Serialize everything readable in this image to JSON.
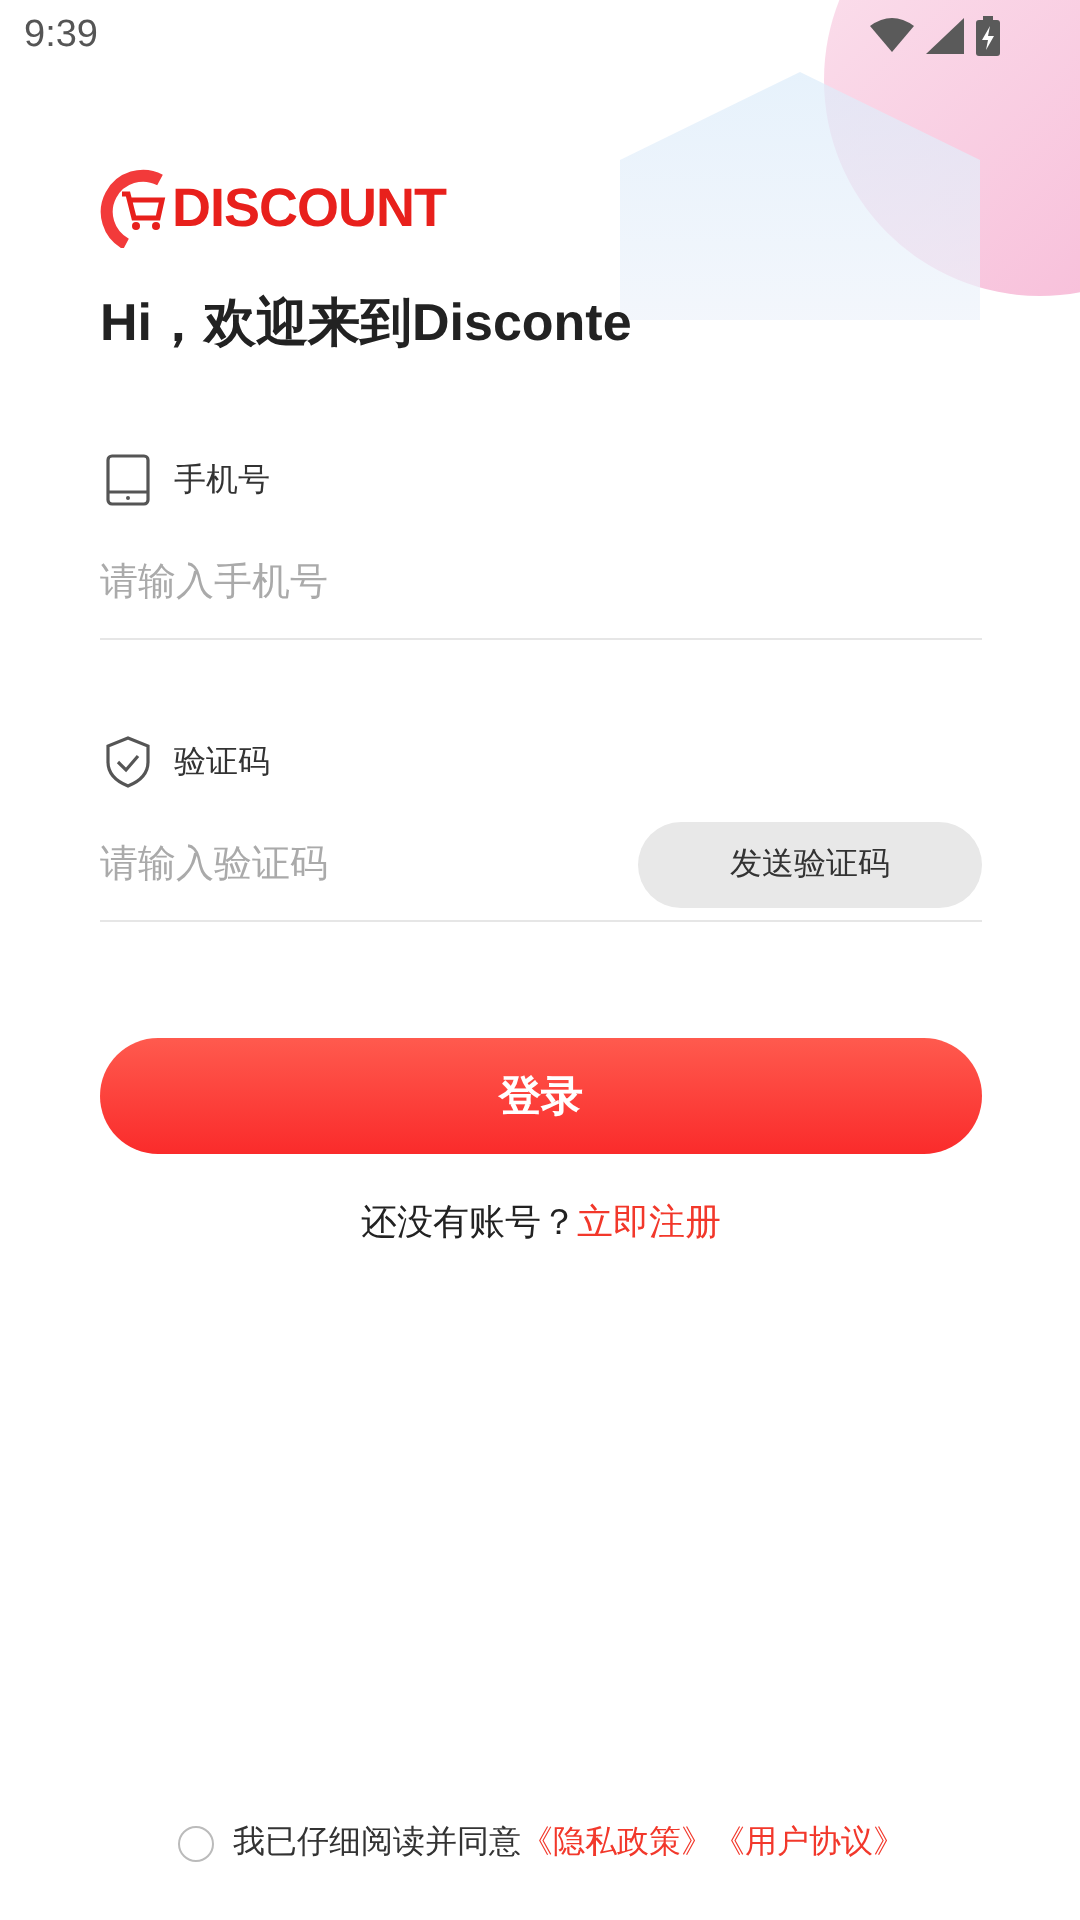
{
  "status_bar": {
    "time": "9:39"
  },
  "logo": {
    "text": "DISCOUNT"
  },
  "greeting": "Hi，欢迎来到Disconte",
  "phone": {
    "label": "手机号",
    "placeholder": "请输入手机号"
  },
  "code": {
    "label": "验证码",
    "placeholder": "请输入验证码",
    "button": "发送验证码"
  },
  "login_button": "登录",
  "register": {
    "prompt": "还没有账号？",
    "link": "立即注册"
  },
  "agreement": {
    "checked": false,
    "text": "我已仔细阅读并同意",
    "links": [
      "《隐私政策》",
      "《用户协议》"
    ]
  }
}
